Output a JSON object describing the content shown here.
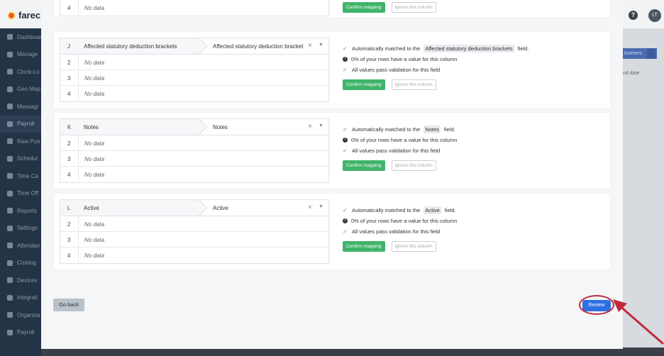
{
  "app": {
    "brand": "farecl",
    "help_label": "?",
    "avatar_initials": "LT",
    "sidebar": [
      {
        "label": "Dashboard",
        "icon": "dashboard-icon"
      },
      {
        "label": "Manage",
        "icon": "user-icon"
      },
      {
        "label": "Clock-Lo",
        "icon": "clock-icon"
      },
      {
        "label": "Geo Map",
        "icon": "map-icon"
      },
      {
        "label": "Messagi",
        "icon": "message-icon"
      },
      {
        "label": "Payroll",
        "icon": "payroll-icon"
      },
      {
        "label": "Raw Pun",
        "icon": "punch-icon"
      },
      {
        "label": "Schedul",
        "icon": "schedule-icon"
      },
      {
        "label": "Time Ca",
        "icon": "timecard-icon"
      },
      {
        "label": "Time Off",
        "icon": "timeoff-icon"
      },
      {
        "label": "Reports",
        "icon": "reports-icon"
      },
      {
        "label": "Settings",
        "icon": "settings-icon"
      },
      {
        "label": "Attendan",
        "icon": "attendance-icon"
      },
      {
        "label": "Costing",
        "icon": "costing-icon"
      },
      {
        "label": "Devices",
        "icon": "devices-icon"
      },
      {
        "label": "Integrati",
        "icon": "integration-icon"
      },
      {
        "label": "Organiza",
        "icon": "organization-icon"
      },
      {
        "label": "Payroll",
        "icon": "payroll-icon"
      }
    ],
    "right_button": "loomers",
    "right_column": "nd date"
  },
  "top_partial": {
    "row_num": "4",
    "row_val": "No data",
    "confirm": "Confirm mapping",
    "ignore": "Ignore this column"
  },
  "mappings": [
    {
      "letter": "J",
      "source": "Affected statutory deduction brackets",
      "target": "Affected statutory deduction bracket",
      "rows": [
        {
          "num": "2",
          "val": "No data"
        },
        {
          "num": "3",
          "val": "No data"
        },
        {
          "num": "4",
          "val": "No data"
        }
      ],
      "matched_prefix": "Automatically matched to the",
      "matched_field": "Affected statutory deduction brackets",
      "matched_suffix": "field.",
      "rows_value": "0% of your rows have a value for this column",
      "validation": "All values pass validation for this field",
      "confirm": "Confirm mapping",
      "ignore": "Ignore this column"
    },
    {
      "letter": "K",
      "source": "Notes",
      "target": "Notes",
      "rows": [
        {
          "num": "2",
          "val": "No data"
        },
        {
          "num": "3",
          "val": "No data"
        },
        {
          "num": "4",
          "val": "No data"
        }
      ],
      "matched_prefix": "Automatically matched to the",
      "matched_field": "Notes",
      "matched_suffix": "field.",
      "rows_value": "0% of your rows have a value for this column",
      "validation": "All values pass validation for this field",
      "confirm": "Confirm mapping",
      "ignore": "Ignore this column"
    },
    {
      "letter": "L",
      "source": "Active",
      "target": "Active",
      "rows": [
        {
          "num": "2",
          "val": "No data"
        },
        {
          "num": "3",
          "val": "No data"
        },
        {
          "num": "4",
          "val": "No data"
        }
      ],
      "matched_prefix": "Automatically matched to the",
      "matched_field": "Active",
      "matched_suffix": "field.",
      "rows_value": "0% of your rows have a value for this column",
      "validation": "All values pass validation for this field",
      "confirm": "Confirm mapping",
      "ignore": "Ignore this column"
    }
  ],
  "footer": {
    "back": "Go back",
    "review": "Review"
  },
  "colors": {
    "confirm": "#3fb46a",
    "review": "#2f6fe4",
    "annotation": "#c0283c"
  }
}
